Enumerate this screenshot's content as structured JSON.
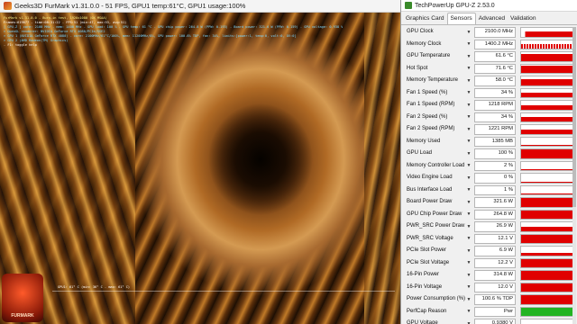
{
  "furmark": {
    "title": "Geeks3D FurMark v1.31.0.0 - 51 FPS, GPU1 temp:61°C, GPU1 usage:100%",
    "hud_lines": [
      {
        "text": "FurMark v1.31.0.0 - Burn-in test, 1920x1080 (0X MSAA)",
        "tone": "hud-yellow"
      },
      {
        "text": "Frames:619877 - time:08:31:22 - FPS:51 (min:47, max:53, avg:51)",
        "tone": "hud-white"
      },
      {
        "text": "[ GPU-Z ] core: 2100 MHz - mem: 1400 MHz - GPU load: 100 % - GPU temp: 61 °C - GPU chip power: 264.8 W (PPW: 0.193) - Board power: 321.6 W (PPW: 0.159) - GPU voltage: 0.938 V",
        "tone": ""
      },
      {
        "text": "> OpenGL renderer: NVIDIA GeForce RTX 4080/PCIe/SSE2",
        "tone": ""
      },
      {
        "text": "> GPU 1 (NVIDIA GeForce RTX 4080) - core: 2100MHz/61°C/100%, mem: 11200MHz/8%, GPU power: 100.6% TDP, fan: 34%, limits:[power:1, temp:0, volt:0, OV:0]",
        "tone": ""
      },
      {
        "text": "> GPU 2 (AMD Radeon(TM) Graphics)",
        "tone": ""
      },
      {
        "text": "- F1: toggle help",
        "tone": "hud-white"
      }
    ],
    "graph_label": "GPU1: 61° C (min: 36° C - max: 61° C)",
    "logo_label": "FURMARK"
  },
  "gpuz": {
    "title": "TechPowerUp GPU-Z 2.53.0",
    "tabs": [
      "Graphics Card",
      "Sensors",
      "Advanced",
      "Validation"
    ],
    "active_tab": 1,
    "sensors": [
      {
        "label": "GPU Clock",
        "value": "2100.0 MHz",
        "fill": 0.6,
        "color": "#e00000",
        "style": "step"
      },
      {
        "label": "Memory Clock",
        "value": "1400.2 MHz",
        "fill": 0.55,
        "color": "#e00000",
        "style": "zigzag"
      },
      {
        "label": "GPU Temperature",
        "value": "61.6 °C",
        "fill": 0.75,
        "color": "#e00000",
        "style": "solid"
      },
      {
        "label": "Hot Spot",
        "value": "71.6 °C",
        "fill": 0.8,
        "color": "#e00000",
        "style": "solid"
      },
      {
        "label": "Memory Temperature",
        "value": "58.0 °C",
        "fill": 0.7,
        "color": "#e00000",
        "style": "solid"
      },
      {
        "label": "Fan 1 Speed (%)",
        "value": "34 %",
        "fill": 0.5,
        "color": "#e00000",
        "style": "solid"
      },
      {
        "label": "Fan 1 Speed (RPM)",
        "value": "1218 RPM",
        "fill": 0.5,
        "color": "#e00000",
        "style": "solid"
      },
      {
        "label": "Fan 2 Speed (%)",
        "value": "34 %",
        "fill": 0.5,
        "color": "#e00000",
        "style": "solid"
      },
      {
        "label": "Fan 2 Speed (RPM)",
        "value": "1221 RPM",
        "fill": 0.5,
        "color": "#e00000",
        "style": "solid"
      },
      {
        "label": "Memory Used",
        "value": "1385 MB",
        "fill": 0.05,
        "color": "#e00000",
        "style": "line"
      },
      {
        "label": "GPU Load",
        "value": "100 %",
        "fill": 1.0,
        "color": "#e00000",
        "style": "solid"
      },
      {
        "label": "Memory Controller Load",
        "value": "2 %",
        "fill": 0.03,
        "color": "#e00000",
        "style": "line"
      },
      {
        "label": "Video Engine Load",
        "value": "0 %",
        "fill": 0.0,
        "color": "#e00000",
        "style": "line"
      },
      {
        "label": "Bus Interface Load",
        "value": "1 %",
        "fill": 0.02,
        "color": "#e00000",
        "style": "line"
      },
      {
        "label": "Board Power Draw",
        "value": "321.6 W",
        "fill": 0.95,
        "color": "#e00000",
        "style": "solid"
      },
      {
        "label": "GPU Chip Power Draw",
        "value": "264.8 W",
        "fill": 0.9,
        "color": "#e00000",
        "style": "solid"
      },
      {
        "label": "PWR_SRC Power Draw",
        "value": "26.9 W",
        "fill": 0.45,
        "color": "#e00000",
        "style": "solid"
      },
      {
        "label": "PWR_SRC Voltage",
        "value": "12.1 V",
        "fill": 0.9,
        "color": "#e00000",
        "style": "solid"
      },
      {
        "label": "PCIe Slot Power",
        "value": "6.9 W",
        "fill": 0.3,
        "color": "#e00000",
        "style": "solid"
      },
      {
        "label": "PCIe Slot Voltage",
        "value": "12.2 V",
        "fill": 0.9,
        "color": "#e00000",
        "style": "solid"
      },
      {
        "label": "16-Pin Power",
        "value": "314.8 W",
        "fill": 0.95,
        "color": "#e00000",
        "style": "solid"
      },
      {
        "label": "16-Pin Voltage",
        "value": "12.0 V",
        "fill": 0.9,
        "color": "#e00000",
        "style": "solid"
      },
      {
        "label": "Power Consumption (%)",
        "value": "100.6 % TDP",
        "fill": 0.95,
        "color": "#e00000",
        "style": "solid"
      },
      {
        "label": "PerfCap Reason",
        "value": "Pwr",
        "fill": 1.0,
        "color": "#22b422",
        "style": "solid"
      },
      {
        "label": "GPU Voltage",
        "value": "0.9380 V",
        "fill": 0.5,
        "color": "#e00000",
        "style": "solid"
      }
    ]
  }
}
